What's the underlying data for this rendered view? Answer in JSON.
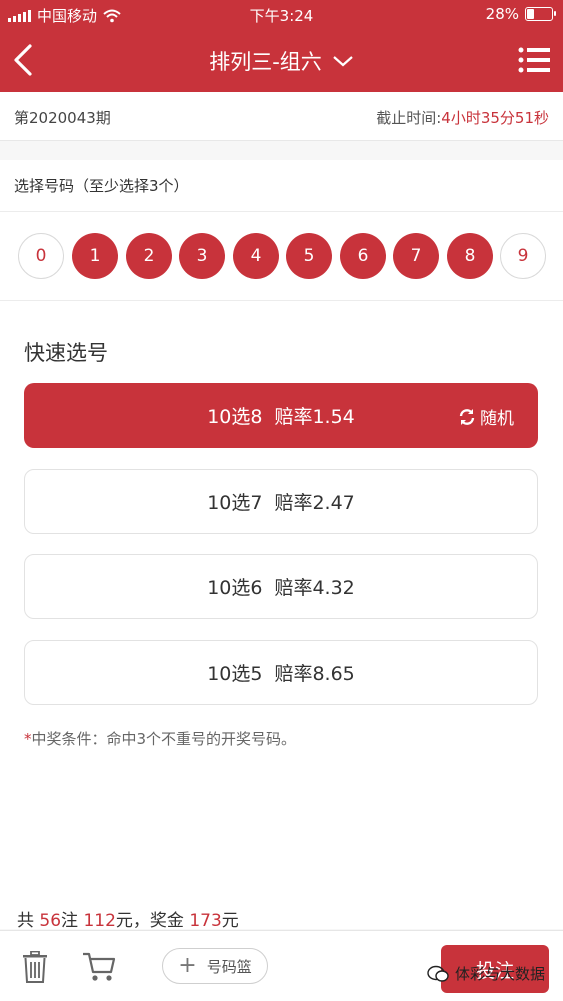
{
  "status_bar": {
    "carrier": "中国移动",
    "time": "下午3:24",
    "battery": "28%",
    "battery_level": 0.28
  },
  "nav": {
    "title": "排列三-组六"
  },
  "period": {
    "issue": "第2020043期",
    "deadline_label": "截止时间:",
    "deadline_value": "4小时35分51秒"
  },
  "pick": {
    "title": "选择号码（至少选择3个）"
  },
  "balls": [
    {
      "num": "0",
      "selected": false
    },
    {
      "num": "1",
      "selected": true
    },
    {
      "num": "2",
      "selected": true
    },
    {
      "num": "3",
      "selected": true
    },
    {
      "num": "4",
      "selected": true
    },
    {
      "num": "5",
      "selected": true
    },
    {
      "num": "6",
      "selected": true
    },
    {
      "num": "7",
      "selected": true
    },
    {
      "num": "8",
      "selected": true
    },
    {
      "num": "9",
      "selected": false
    }
  ],
  "quick": {
    "title": "快速选号",
    "random_label": "随机",
    "options": [
      {
        "label": "10选8",
        "odds": "赔率1.54",
        "selected": true
      },
      {
        "label": "10选7",
        "odds": "赔率2.47",
        "selected": false
      },
      {
        "label": "10选6",
        "odds": "赔率4.32",
        "selected": false
      },
      {
        "label": "10选5",
        "odds": "赔率8.65",
        "selected": false
      }
    ],
    "note_star": "*",
    "note": "中奖条件：命中3个不重号的开奖号码。"
  },
  "summary": {
    "prefix": "共",
    "bets": "56",
    "bets_unit": "注",
    "amount": "112",
    "amount_unit": "元，奖金",
    "prize": "173",
    "prize_unit": "元"
  },
  "bottom": {
    "basket_label": "号码篮",
    "bet_label": "投注",
    "watermark": "体彩与大数据"
  },
  "colors": {
    "accent": "#c8333b"
  }
}
